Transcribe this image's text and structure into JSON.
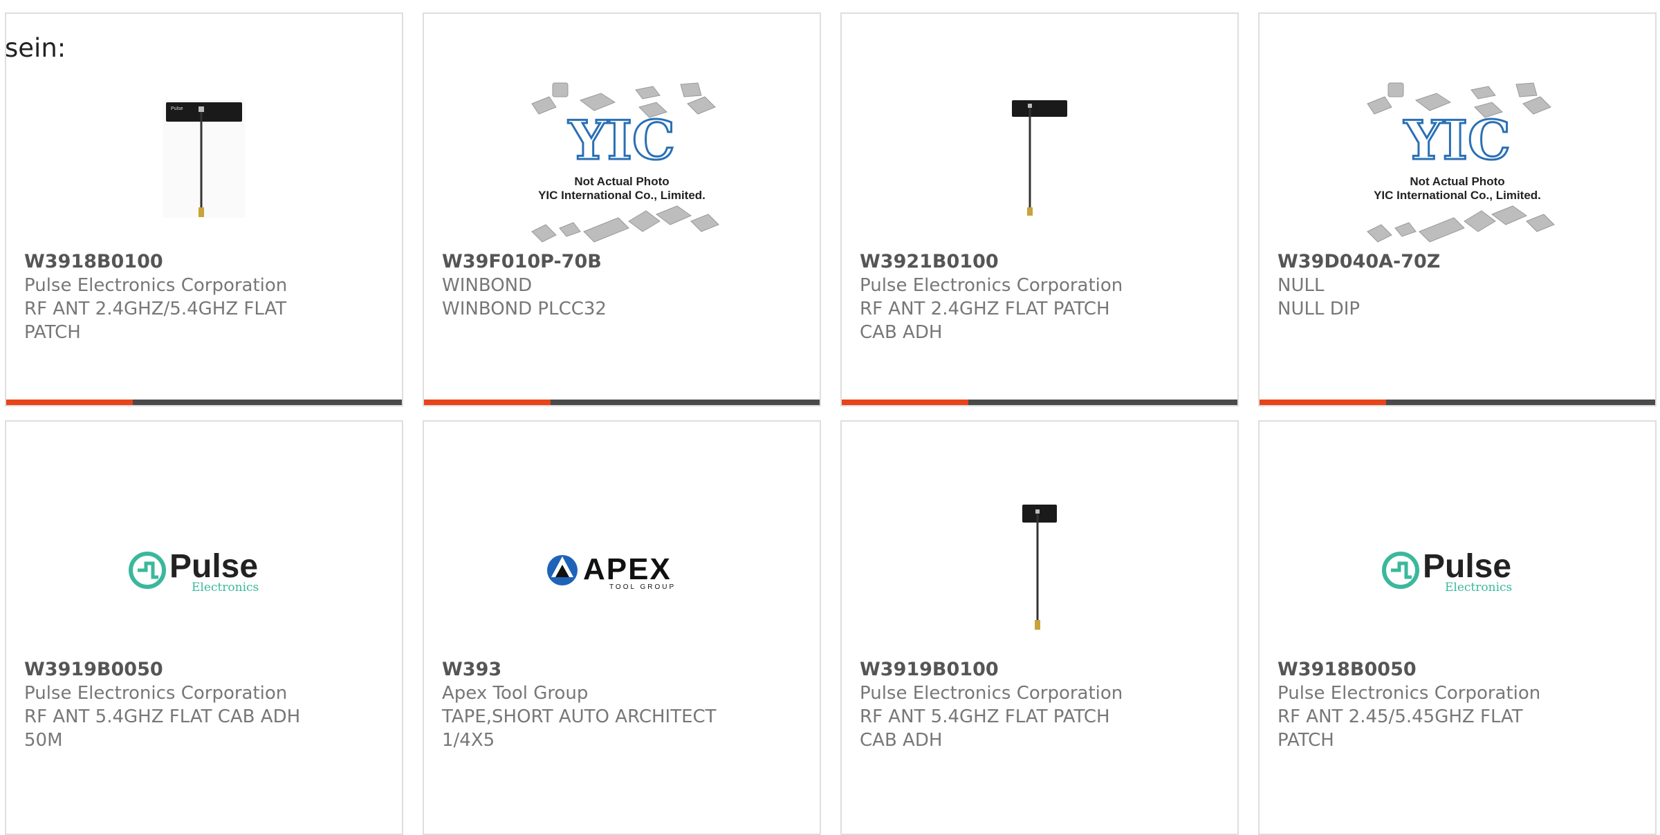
{
  "intro_text": "sein:",
  "products": [
    {
      "part_number": "W3918B0100",
      "manufacturer": "Pulse Electronics Corporation",
      "description": "RF ANT 2.4GHZ/5.4GHZ FLAT PATCH",
      "image": "antenna-small"
    },
    {
      "part_number": "W39F010P-70B",
      "manufacturer": "WINBOND",
      "description": "WINBOND PLCC32",
      "image": "placeholder"
    },
    {
      "part_number": "W3921B0100",
      "manufacturer": "Pulse Electronics Corporation",
      "description": "RF ANT 2.4GHZ FLAT PATCH CAB ADH",
      "image": "antenna-small"
    },
    {
      "part_number": "W39D040A-70Z",
      "manufacturer": "NULL",
      "description": "NULL DIP",
      "image": "placeholder"
    },
    {
      "part_number": "W3919B0050",
      "manufacturer": "Pulse Electronics Corporation",
      "description": "RF ANT 5.4GHZ FLAT CAB ADH 50M",
      "image": "pulse-logo"
    },
    {
      "part_number": "W393",
      "manufacturer": "Apex Tool Group",
      "description": "TAPE,SHORT AUTO ARCHITECT 1/4X5",
      "image": "apex-logo"
    },
    {
      "part_number": "W3919B0100",
      "manufacturer": "Pulse Electronics Corporation",
      "description": "RF ANT 5.4GHZ FLAT PATCH CAB ADH",
      "image": "antenna-small"
    },
    {
      "part_number": "W3918B0050",
      "manufacturer": "Pulse Electronics Corporation",
      "description": "RF ANT 2.45/5.45GHZ FLAT PATCH",
      "image": "pulse-logo"
    }
  ],
  "placeholder": {
    "logo_text": "YIC",
    "caption_line1": "Not Actual Photo",
    "caption_line2": "YIC International Co., Limited."
  },
  "logos": {
    "pulse_name": "Pulse",
    "pulse_sub": "Electronics",
    "apex_name": "APEX",
    "apex_sub": "TOOL GROUP"
  },
  "colors": {
    "accent": "#e8431a",
    "bar": "#4a4a4a",
    "pulse_teal": "#3bb89c"
  }
}
